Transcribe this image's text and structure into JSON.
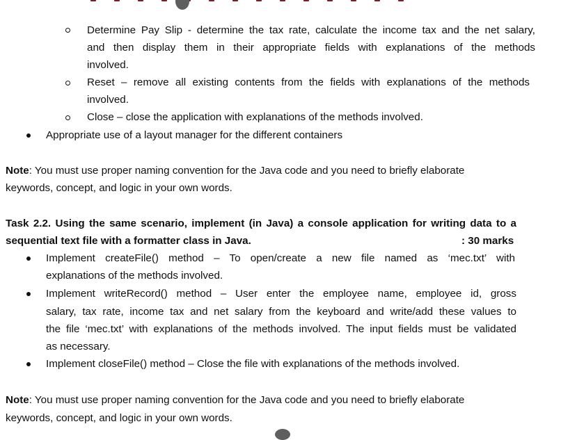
{
  "sub_items": [
    {
      "lines": [
        "Determine Pay Slip - determine the tax rate, calculate the income tax and the net salary,",
        "and then display them in their appropriate fields with explanations of the methods",
        "involved."
      ]
    },
    {
      "lines": [
        "Reset – remove all existing contents from the fields with explanations of the methods",
        "involved."
      ]
    },
    {
      "lines": [
        "Close – close the application with explanations of the methods involved."
      ]
    }
  ],
  "top_bullet": "Appropriate use of a layout manager for the different containers",
  "note1": {
    "label": "Note",
    "line1": ": You must use proper naming convention for the Java code and you need to briefly elaborate",
    "line2": "keywords, concept, and logic in your own words."
  },
  "task": {
    "line1": "Task 2.2. Using the same scenario, implement (in Java) a console application for writing data to a",
    "line2": "sequential text file with a formatter class in Java.",
    "marks": ": 30 marks"
  },
  "task_items": [
    {
      "lines": [
        "Implement createFile() method – To open/create a new file named as ‘mec.txt’ with",
        "explanations of the methods involved."
      ]
    },
    {
      "lines": [
        "Implement writeRecord() method – User enter the employee name, employee id, gross",
        "salary, tax rate, income tax and net salary from the keyboard and write/add these values to",
        "the file ‘mec.txt’ with explanations of the methods involved. The input fields must be validated",
        "as necessary."
      ]
    },
    {
      "lines": [
        "Implement closeFile() method – Close the file with explanations of the methods involved."
      ]
    }
  ],
  "note2": {
    "label": "Note",
    "line1": ": You must use proper naming convention for the Java code and you need to briefly elaborate",
    "line2": "keywords, concept, and logic in your own words."
  }
}
